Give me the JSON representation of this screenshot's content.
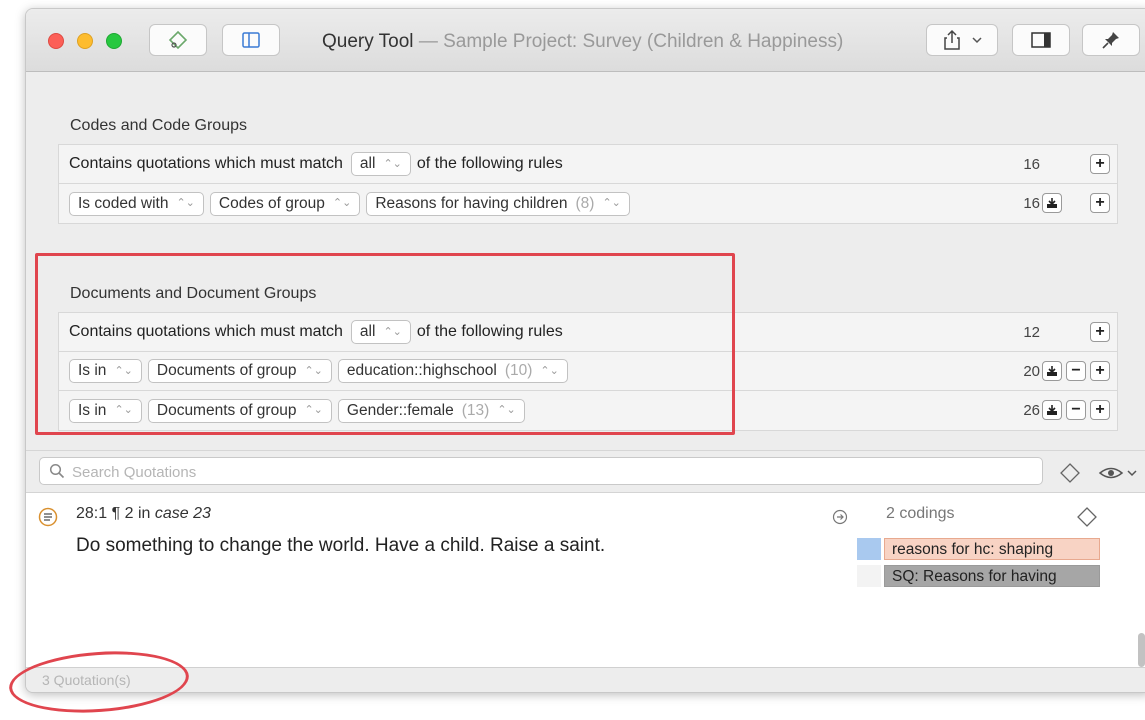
{
  "window": {
    "title": "Query Tool",
    "subtitle": "— Sample Project: Survey (Children & Happiness)"
  },
  "toolbar": {
    "icons": [
      "code-icon",
      "sidebar-icon",
      "share-icon",
      "chevron-down-icon",
      "panel-icon",
      "pin-icon"
    ]
  },
  "codes_section": {
    "title": "Codes and Code Groups",
    "header_row": {
      "prefix": "Contains quotations which must match",
      "match": "all",
      "suffix": "of the following rules",
      "count": "16"
    },
    "rules": [
      {
        "op": "Is coded with",
        "scope": "Codes of group",
        "value": "Reasons for having children",
        "value_count": "(8)",
        "count": "16"
      }
    ]
  },
  "documents_section": {
    "title": "Documents and Document Groups",
    "header_row": {
      "prefix": "Contains quotations which must match",
      "match": "all",
      "suffix": "of the following rules",
      "count": "12"
    },
    "rules": [
      {
        "op": "Is in",
        "scope": "Documents of group",
        "value": "education::highschool",
        "value_count": "(10)",
        "count": "20"
      },
      {
        "op": "Is in",
        "scope": "Documents of group",
        "value": "Gender::female",
        "value_count": "(13)",
        "count": "26"
      }
    ]
  },
  "search": {
    "placeholder": "Search Quotations"
  },
  "quotation": {
    "id": "28:1",
    "paragraph": "¶ 2 in",
    "document": "case 23",
    "text": "Do something to change the world. Have a child. Raise a saint.",
    "codings_label": "2 codings",
    "codes": [
      {
        "label": "reasons for hc: shaping",
        "bg": "#f8d3c4",
        "border": "#e8a98f",
        "swatch": "#a9c9ef"
      },
      {
        "label": "SQ: Reasons for having",
        "bg": "#a6a6a6",
        "border": "#9a9a9a",
        "swatch": "#f3f3f3"
      }
    ]
  },
  "status": {
    "text": "3 Quotation(s)"
  },
  "colors": {
    "highlight": "#e0454e",
    "close": "#fc5f57",
    "minimize": "#fdbc2e",
    "zoom": "#28c840"
  }
}
